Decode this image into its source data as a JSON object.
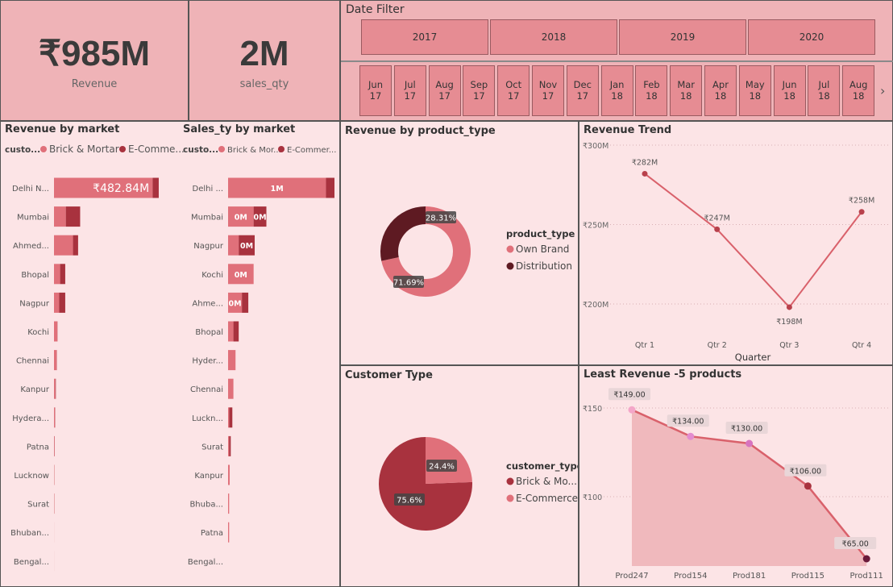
{
  "kpis": {
    "revenue": {
      "value": "₹985M",
      "label": "Revenue"
    },
    "qty": {
      "value": "2M",
      "label": "sales_qty"
    }
  },
  "date_filter": {
    "title": "Date Filter",
    "years": [
      "2017",
      "2018",
      "2019",
      "2020"
    ],
    "months": [
      {
        "m": "Jun",
        "y": "17"
      },
      {
        "m": "Jul",
        "y": "17"
      },
      {
        "m": "Aug",
        "y": "17"
      },
      {
        "m": "Sep",
        "y": "17"
      },
      {
        "m": "Oct",
        "y": "17"
      },
      {
        "m": "Nov",
        "y": "17"
      },
      {
        "m": "Dec",
        "y": "17"
      },
      {
        "m": "Jan",
        "y": "18"
      },
      {
        "m": "Feb",
        "y": "18"
      },
      {
        "m": "Mar",
        "y": "18"
      },
      {
        "m": "Apr",
        "y": "18"
      },
      {
        "m": "May",
        "y": "18"
      },
      {
        "m": "Jun",
        "y": "18"
      },
      {
        "m": "Jul",
        "y": "18"
      },
      {
        "m": "Aug",
        "y": "18"
      }
    ],
    "next_icon": "chevron-right-icon"
  },
  "colors": {
    "brick": "#e0707a",
    "ecom": "#a8323e",
    "own": "#e0707a",
    "dist": "#5e1a22",
    "line": "#d9616b",
    "panel_bg": "#fce4e6"
  },
  "chart_data": [
    {
      "id": "revenue_by_market",
      "type": "bar",
      "orientation": "horizontal",
      "stacked": true,
      "title": "Revenue by market",
      "legend_title": "custo...",
      "legend": [
        "Brick & Mortar",
        "E-Comme..."
      ],
      "categories": [
        "Delhi N...",
        "Mumbai",
        "Ahmed...",
        "Bhopal",
        "Nagpur",
        "Kochi",
        "Chennai",
        "Kanpur",
        "Hydera...",
        "Patna",
        "Lucknow",
        "Surat",
        "Bhuban...",
        "Bengal..."
      ],
      "series": [
        {
          "name": "Brick & Mortar",
          "values": [
            482.84,
            58,
            93,
            30,
            25,
            16,
            13,
            7,
            5,
            2,
            1.5,
            1.5,
            0.3,
            0.2
          ]
        },
        {
          "name": "E-Comme...",
          "values": [
            30,
            70,
            25,
            25,
            30,
            1,
            1,
            2,
            1,
            1,
            0.5,
            0.5,
            0,
            0
          ]
        }
      ],
      "data_labels": [
        "₹482.84M"
      ]
    },
    {
      "id": "sales_by_market",
      "type": "bar",
      "orientation": "horizontal",
      "stacked": true,
      "title": "Sales_ty by market",
      "legend_title": "custo...",
      "legend": [
        "Brick & Mor...",
        "E-Commer..."
      ],
      "categories": [
        "Delhi ...",
        "Mumbai",
        "Nagpur",
        "Kochi",
        "Ahme...",
        "Bhopal",
        "Hyder...",
        "Chennai",
        "Luckn...",
        "Surat",
        "Kanpur",
        "Bhuba...",
        "Patna",
        "Bengal..."
      ],
      "series": [
        {
          "name": "Brick & Mor...",
          "values": [
            0.92,
            0.24,
            0.1,
            0.24,
            0.13,
            0.05,
            0.07,
            0.05,
            0.01,
            0.01,
            0.015,
            0.01,
            0.01,
            0
          ]
        },
        {
          "name": "E-Commer...",
          "values": [
            0.08,
            0.12,
            0.15,
            0,
            0.06,
            0.05,
            0,
            0,
            0.03,
            0.015,
            0,
            0,
            0,
            0
          ]
        }
      ],
      "data_labels": [
        [
          "1M",
          ""
        ],
        [
          "0M",
          "0M"
        ],
        [
          "",
          "0M"
        ],
        [
          "0M",
          ""
        ],
        [
          "0M",
          ""
        ]
      ]
    },
    {
      "id": "revenue_by_product_type",
      "type": "pie",
      "donut": true,
      "title": "Revenue by product_type",
      "legend_title": "product_type",
      "slices": [
        {
          "name": "Own Brand",
          "value": 71.69,
          "label": "71.69%"
        },
        {
          "name": "Distribution",
          "value": 28.31,
          "label": "28.31%"
        }
      ]
    },
    {
      "id": "revenue_trend",
      "type": "line",
      "title": "Revenue Trend",
      "xlabel": "Quarter",
      "categories": [
        "Qtr 1",
        "Qtr 2",
        "Qtr 3",
        "Qtr 4"
      ],
      "values": [
        282,
        247,
        198,
        258
      ],
      "data_labels": [
        "₹282M",
        "₹247M",
        "₹198M",
        "₹258M"
      ],
      "yticks": [
        {
          "v": 200,
          "label": "₹200M"
        },
        {
          "v": 250,
          "label": "₹250M"
        },
        {
          "v": 300,
          "label": "₹300M"
        }
      ],
      "ylim": [
        180,
        300
      ]
    },
    {
      "id": "customer_type",
      "type": "pie",
      "title": "Customer Type",
      "legend_title": "customer_type",
      "slices": [
        {
          "name": "Brick & Mo...",
          "value": 75.6,
          "label": "75.6%"
        },
        {
          "name": "E-Commerce",
          "value": 24.4,
          "label": "24.4%"
        }
      ]
    },
    {
      "id": "least_revenue_products",
      "type": "area",
      "title": "Least Revenue -5 products",
      "categories": [
        "Prod247",
        "Prod154",
        "Prod181",
        "Prod115",
        "Prod111"
      ],
      "values": [
        149.0,
        134.0,
        130.0,
        106.0,
        65.0
      ],
      "data_labels": [
        "₹149.00",
        "₹134.00",
        "₹130.00",
        "₹106.00",
        "₹65.00"
      ],
      "yticks": [
        {
          "v": 100,
          "label": "₹100"
        },
        {
          "v": 150,
          "label": "₹150"
        }
      ],
      "ylim": [
        60,
        160
      ]
    }
  ]
}
